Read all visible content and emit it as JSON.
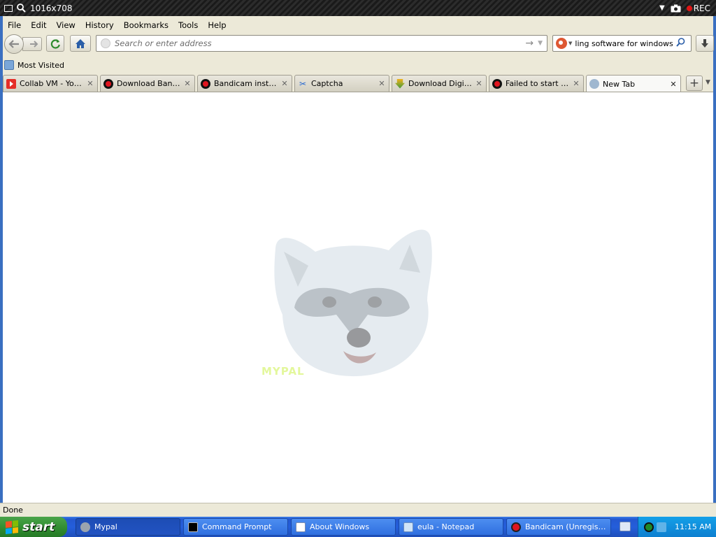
{
  "recorder": {
    "resolution": "1016x708",
    "rec_label": "REC"
  },
  "menu": {
    "items": [
      "File",
      "Edit",
      "View",
      "History",
      "Bookmarks",
      "Tools",
      "Help"
    ]
  },
  "navbar": {
    "url_placeholder": "Search or enter address",
    "search_value": "ling software for windows xp"
  },
  "bookmarks": {
    "most_visited": "Most Visited"
  },
  "tabs": [
    {
      "title": "Collab VM - YouTu...",
      "icon": "youtube-icon"
    },
    {
      "title": "Download Bandic...",
      "icon": "bandicam-icon"
    },
    {
      "title": "Bandicam installat...",
      "icon": "bandicam-icon"
    },
    {
      "title": "Captcha",
      "icon": "captcha-icon"
    },
    {
      "title": "Download Digital ...",
      "icon": "download-arrow-icon"
    },
    {
      "title": "Failed to start au...",
      "icon": "bandicam-icon"
    },
    {
      "title": "New Tab",
      "icon": "globe-icon",
      "active": true
    }
  ],
  "status": {
    "text": "Done"
  },
  "taskbar": {
    "start_label": "start",
    "buttons": [
      {
        "label": "Mypal",
        "icon": "mypal-icon",
        "active": true
      },
      {
        "label": "Command Prompt",
        "icon": "cmd-icon"
      },
      {
        "label": "About Windows",
        "icon": "window-icon"
      },
      {
        "label": "eula - Notepad",
        "icon": "notepad-icon"
      },
      {
        "label": "Bandicam (Unregiste...",
        "icon": "bandicam-icon"
      }
    ],
    "clock": "11:15 AM"
  }
}
